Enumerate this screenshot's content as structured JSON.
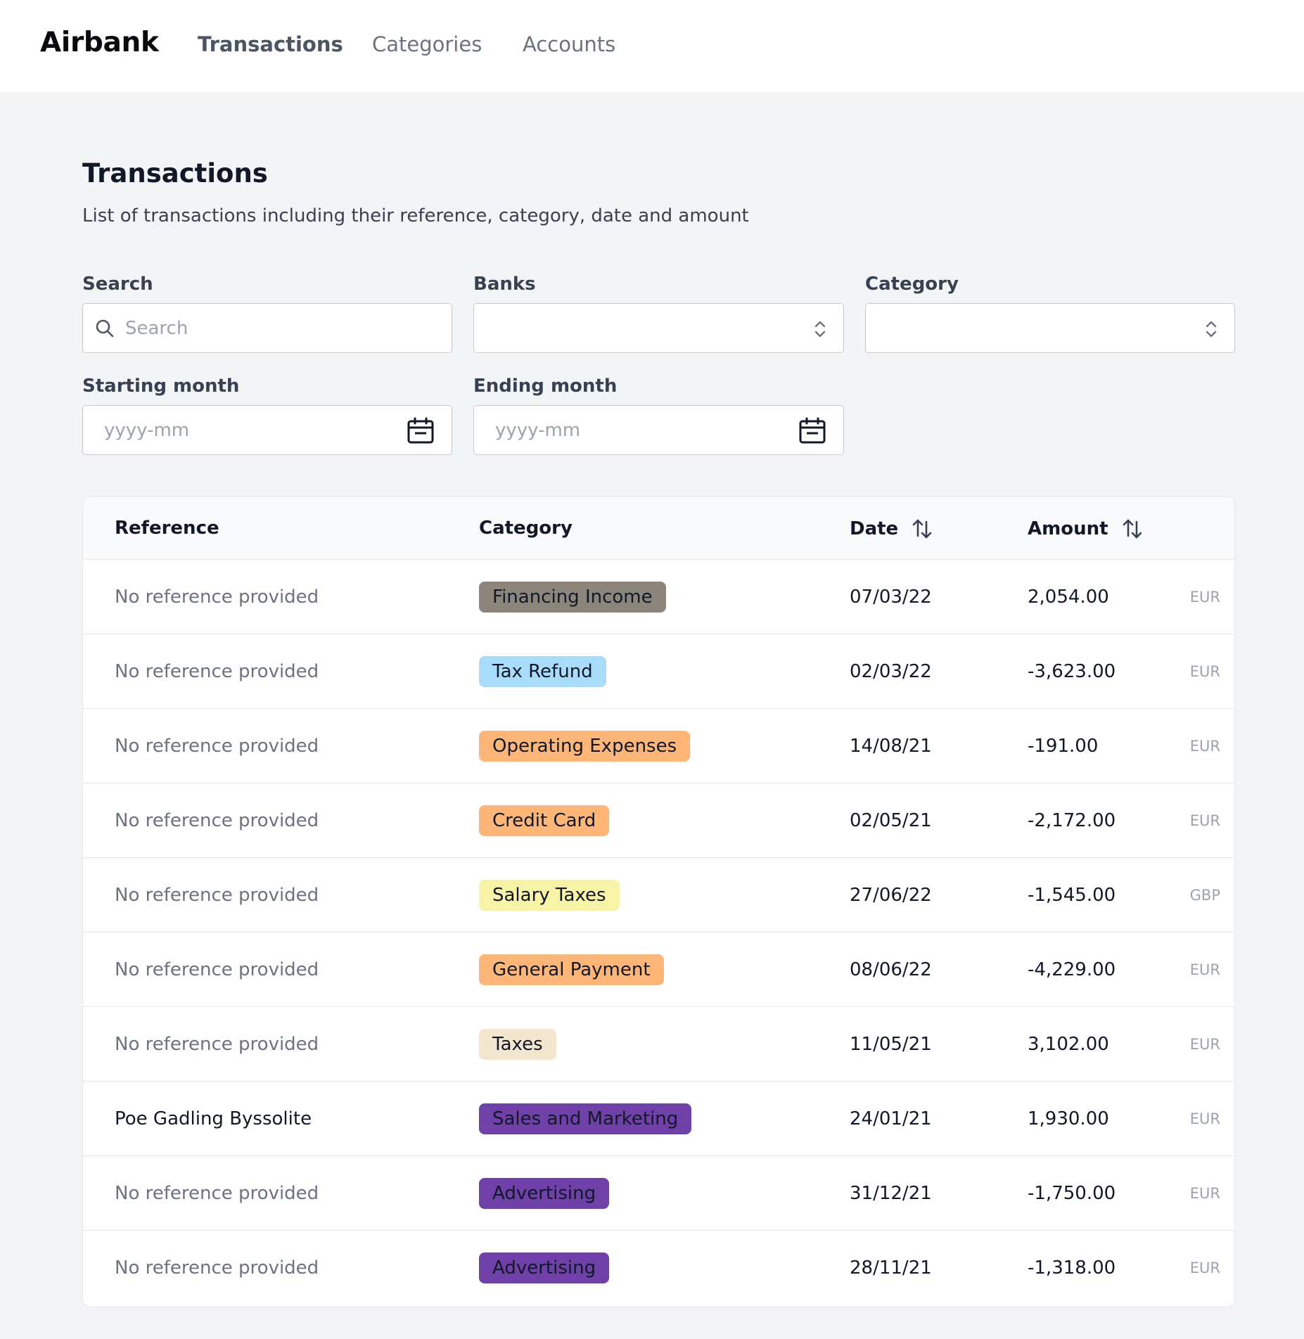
{
  "nav": {
    "brand": "Airbank",
    "links": [
      "Transactions",
      "Categories",
      "Accounts"
    ]
  },
  "page": {
    "title": "Transactions",
    "description": "List of transactions including their reference, category, date and amount"
  },
  "filters": {
    "search_label": "Search",
    "search_placeholder": "Search",
    "banks_label": "Banks",
    "category_label": "Category",
    "start_label": "Starting month",
    "start_placeholder": "yyyy-mm",
    "end_label": "Ending month",
    "end_placeholder": "yyyy-mm"
  },
  "table": {
    "headers": {
      "reference": "Reference",
      "category": "Category",
      "date": "Date",
      "amount": "Amount"
    },
    "rows": [
      {
        "reference": "No reference provided",
        "category": "Financing Income",
        "color": "#8c857b",
        "date": "07/03/22",
        "amount": "2,054.00",
        "currency": "EUR"
      },
      {
        "reference": "No reference provided",
        "category": "Tax Refund",
        "color": "#a9dcfa",
        "date": "02/03/22",
        "amount": "-3,623.00",
        "currency": "EUR"
      },
      {
        "reference": "No reference provided",
        "category": "Operating Expenses",
        "color": "#fdb578",
        "date": "14/08/21",
        "amount": "-191.00",
        "currency": "EUR"
      },
      {
        "reference": "No reference provided",
        "category": "Credit Card",
        "color": "#fdb578",
        "date": "02/05/21",
        "amount": "-2,172.00",
        "currency": "EUR"
      },
      {
        "reference": "No reference provided",
        "category": "Salary Taxes",
        "color": "#f8f3a6",
        "date": "27/06/22",
        "amount": "-1,545.00",
        "currency": "GBP"
      },
      {
        "reference": "No reference provided",
        "category": "General Payment",
        "color": "#fdb578",
        "date": "08/06/22",
        "amount": "-4,229.00",
        "currency": "EUR"
      },
      {
        "reference": "No reference provided",
        "category": "Taxes",
        "color": "#f2e6cf",
        "date": "11/05/21",
        "amount": "3,102.00",
        "currency": "EUR"
      },
      {
        "reference": "Poe Gadling Byssolite",
        "category": "Sales and Marketing",
        "color": "#6f40a8",
        "date": "24/01/21",
        "amount": "1,930.00",
        "currency": "EUR"
      },
      {
        "reference": "No reference provided",
        "category": "Advertising",
        "color": "#6f40a8",
        "date": "31/12/21",
        "amount": "-1,750.00",
        "currency": "EUR"
      },
      {
        "reference": "No reference provided",
        "category": "Advertising",
        "color": "#6f40a8",
        "date": "28/11/21",
        "amount": "-1,318.00",
        "currency": "EUR"
      }
    ]
  }
}
